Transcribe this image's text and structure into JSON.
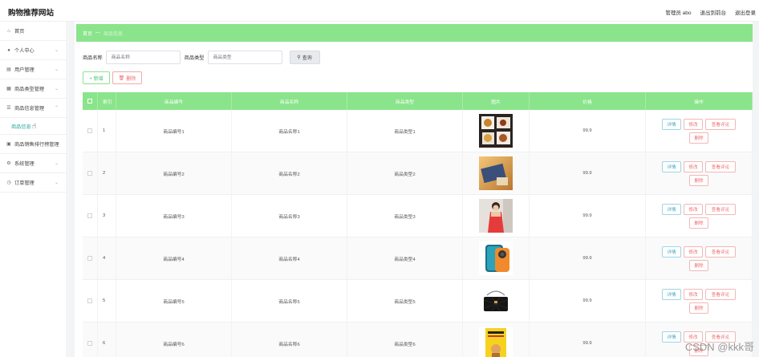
{
  "app": {
    "title": "购物推荐网站"
  },
  "topbar": {
    "role_user": "管理员 abo",
    "back_front": "退出到前台",
    "logout": "退出登录"
  },
  "sidebar": {
    "items": [
      {
        "label": "首页",
        "icon": "home-icon"
      },
      {
        "label": "个人中心",
        "icon": "user-icon"
      },
      {
        "label": "用户管理",
        "icon": "users-icon"
      },
      {
        "label": "商品类型管理",
        "icon": "category-icon"
      },
      {
        "label": "商品信息管理",
        "icon": "product-icon"
      },
      {
        "label": "商品信息",
        "icon": "",
        "sub": true
      },
      {
        "label": "商品销售排行榜管理",
        "icon": "chart-icon"
      },
      {
        "label": "系统管理",
        "icon": "gear-icon"
      },
      {
        "label": "订单管理",
        "icon": "order-icon"
      }
    ]
  },
  "breadcrumb": {
    "home": "首页",
    "separator": "—",
    "current": "商品信息"
  },
  "search": {
    "name_label": "商品名称",
    "name_placeholder": "商品名称",
    "type_label": "商品类型",
    "type_placeholder": "商品类型",
    "button": "查询"
  },
  "actions": {
    "add": "+ 新增",
    "delete": "删除"
  },
  "table": {
    "headers": {
      "index": "索引",
      "code": "商品编号",
      "name": "商品名称",
      "type": "商品类型",
      "image": "图片",
      "price": "价格",
      "ops": "操作"
    },
    "rows": [
      {
        "idx": "1",
        "code": "商品编号1",
        "name": "商品名称1",
        "type": "商品类型1",
        "price": "99.9",
        "img": "food-photo"
      },
      {
        "idx": "2",
        "code": "商品编号2",
        "name": "商品名称2",
        "type": "商品类型2",
        "price": "99.9",
        "img": "tablet-photo"
      },
      {
        "idx": "3",
        "code": "商品编号3",
        "name": "商品名称3",
        "type": "商品类型3",
        "price": "99.9",
        "img": "dress-photo"
      },
      {
        "idx": "4",
        "code": "商品编号4",
        "name": "商品名称4",
        "type": "商品类型4",
        "price": "99.9",
        "img": "phone-photo"
      },
      {
        "idx": "5",
        "code": "商品编号5",
        "name": "商品名称5",
        "type": "商品类型5",
        "price": "99.9",
        "img": "bag-photo"
      },
      {
        "idx": "6",
        "code": "商品编号6",
        "name": "商品名称6",
        "type": "商品类型6",
        "price": "99.9",
        "img": "book-photo"
      }
    ],
    "ops": {
      "detail": "详情",
      "edit": "修改",
      "review": "查看评论",
      "delete": "删除"
    }
  },
  "watermark": "CSDN @kkk哥",
  "colors": {
    "accent": "#8ae48b",
    "teal": "#2aa89c",
    "danger": "#f06b6b"
  }
}
